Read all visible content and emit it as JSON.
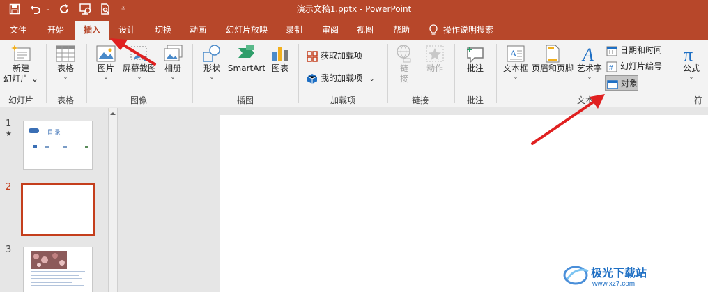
{
  "titlebar": {
    "title": "演示文稿1.pptx  -  PowerPoint",
    "qat": [
      {
        "name": "save-icon",
        "glyph": "💾"
      },
      {
        "name": "undo-icon",
        "glyph": "↶"
      },
      {
        "name": "undo-dropdown-icon",
        "glyph": "⌄"
      },
      {
        "name": "redo-icon",
        "glyph": "↻"
      },
      {
        "name": "start-from-beginning-icon",
        "glyph": "⊡"
      },
      {
        "name": "print-preview-icon",
        "glyph": "⊕"
      },
      {
        "name": "customize-qat-icon",
        "glyph": "⩡"
      }
    ]
  },
  "tabs": [
    {
      "label": "文件"
    },
    {
      "label": "开始"
    },
    {
      "label": "插入"
    },
    {
      "label": "设计"
    },
    {
      "label": "切换"
    },
    {
      "label": "动画"
    },
    {
      "label": "幻灯片放映"
    },
    {
      "label": "录制"
    },
    {
      "label": "审阅"
    },
    {
      "label": "视图"
    },
    {
      "label": "帮助"
    },
    {
      "label": "操作说明搜索"
    }
  ],
  "ribbon": {
    "new_slide": {
      "line1": "新建",
      "line2": "幻灯片"
    },
    "table": "表格",
    "picture": "图片",
    "screenshot": "屏幕截图",
    "album": "相册",
    "shapes": "形状",
    "smartart": "SmartArt",
    "chart": "图表",
    "get_addins": "获取加载项",
    "my_addins": "我的加载项",
    "link": {
      "line1": "链",
      "line2": "接"
    },
    "action": "动作",
    "comment": "批注",
    "textbox": "文本框",
    "header_footer": "页眉和页脚",
    "wordart": "艺术字",
    "date_time": "日期和时间",
    "slide_number": "幻灯片编号",
    "object": "对象",
    "equation": "公式",
    "groups": {
      "slides": "幻灯片",
      "tables": "表格",
      "images": "图像",
      "illustrations": "插图",
      "addins": "加载项",
      "links": "链接",
      "comments": "批注",
      "text": "文本",
      "symbols": "符"
    }
  },
  "slides": {
    "numbers": [
      "1",
      "2",
      "3"
    ],
    "star": "★",
    "thumb1_title": "目    录"
  },
  "colors": {
    "accent": "#b7472a",
    "selected": "#c43e1c",
    "arrow": "#e02020"
  },
  "watermark": {
    "text": "极光下载站",
    "url": "www.xz7.com"
  }
}
